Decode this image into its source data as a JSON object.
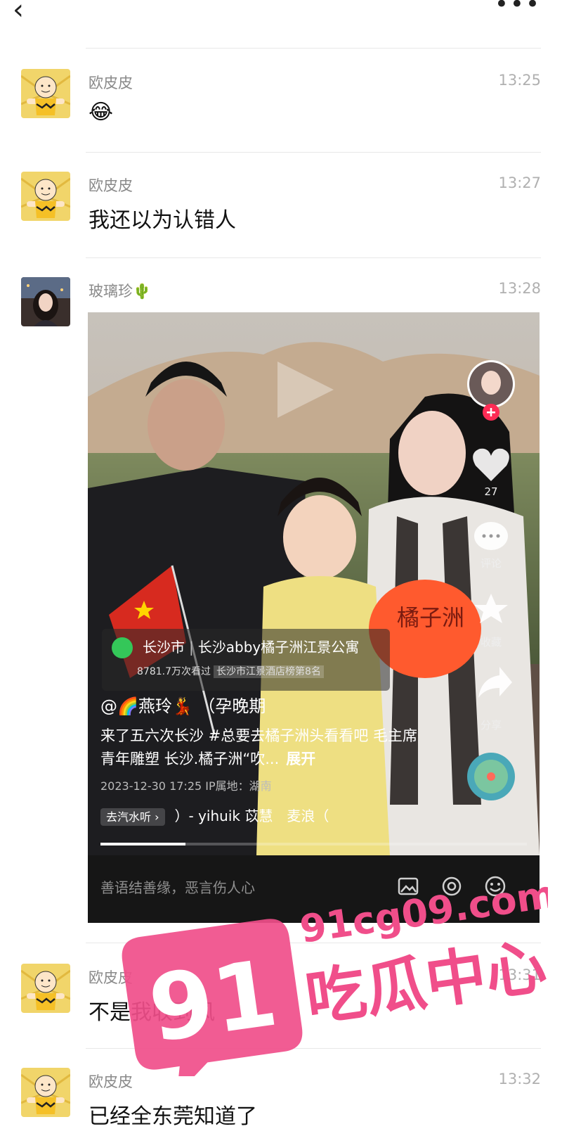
{
  "topbar": {
    "back_glyph": "‹",
    "more_glyph": "•••"
  },
  "messages": [
    {
      "name": "欧皮皮",
      "time": "13:25",
      "text": "😂"
    },
    {
      "name": "欧皮皮",
      "time": "13:27",
      "text": "我还以为认错人"
    },
    {
      "name": "玻璃珍🌵",
      "time": "13:28"
    },
    {
      "name": "欧皮皮",
      "time": "13:31",
      "text": "不是我收到风"
    },
    {
      "name": "欧皮皮",
      "time": "13:32",
      "text": "已经全东莞知道了"
    }
  ],
  "video": {
    "location_city": "长沙市",
    "location_place": "长沙abby橘子洲江景公寓",
    "location_views": "8781.7万次看过",
    "location_rank": "长沙市江景酒店榜第8名",
    "author": "@🌈燕玲💃 （孕晚期",
    "description": "来了五六次长沙 #总要去橘子洲头看看吧 毛主席青年雕塑 长沙.橘子洲“吹...",
    "expand": "展开",
    "datetime": "2023-12-30 17:25  IP属地：湖南",
    "music_button": "去汽水听 ›",
    "music": "）- yihuik 苡慧　麦浪（",
    "progress": 0.2,
    "likes": "27",
    "comment_label": "评论",
    "favorite_label": "收藏",
    "share_label": "分享",
    "comment_placeholder": "善语结善缘，恶言伤人心",
    "fan_text": "橘子洲"
  },
  "watermark": {
    "number": "91",
    "domain": "91cg09.com",
    "brand": "吃瓜中心"
  },
  "colors": {
    "watermark": "#f04e8a",
    "follow": "#fe2c55"
  }
}
